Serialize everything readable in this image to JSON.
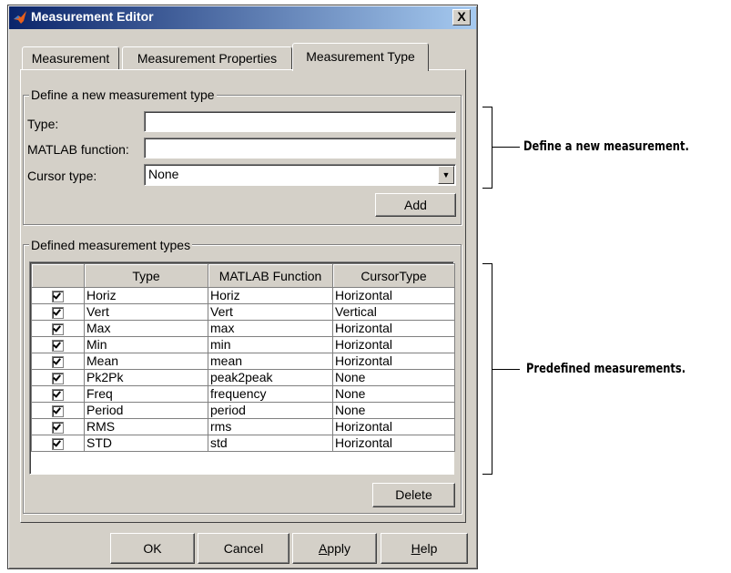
{
  "window": {
    "title": "Measurement Editor",
    "close_label": "X"
  },
  "tabs": [
    {
      "label": "Measurement",
      "active": false
    },
    {
      "label": "Measurement Properties",
      "active": false
    },
    {
      "label": "Measurement Type",
      "active": true
    }
  ],
  "define_group": {
    "legend": "Define a new measurement type",
    "type_label": "Type:",
    "type_value": "",
    "function_label": "MATLAB function:",
    "function_value": "",
    "cursor_label": "Cursor type:",
    "cursor_value": "None",
    "add_label": "Add"
  },
  "defined_group": {
    "legend": "Defined measurement types",
    "columns": [
      "",
      "Type",
      "MATLAB Function",
      "CursorType"
    ],
    "rows": [
      {
        "checked": true,
        "type": "Horiz",
        "function": "Horiz",
        "cursor": "Horizontal"
      },
      {
        "checked": true,
        "type": "Vert",
        "function": "Vert",
        "cursor": "Vertical"
      },
      {
        "checked": true,
        "type": "Max",
        "function": "max",
        "cursor": "Horizontal"
      },
      {
        "checked": true,
        "type": "Min",
        "function": "min",
        "cursor": "Horizontal"
      },
      {
        "checked": true,
        "type": "Mean",
        "function": "mean",
        "cursor": "Horizontal"
      },
      {
        "checked": true,
        "type": "Pk2Pk",
        "function": "peak2peak",
        "cursor": "None"
      },
      {
        "checked": true,
        "type": "Freq",
        "function": "frequency",
        "cursor": "None"
      },
      {
        "checked": true,
        "type": "Period",
        "function": "period",
        "cursor": "None"
      },
      {
        "checked": true,
        "type": "RMS",
        "function": "rms",
        "cursor": "Horizontal"
      },
      {
        "checked": true,
        "type": "STD",
        "function": "std",
        "cursor": "Horizontal"
      }
    ],
    "delete_label": "Delete"
  },
  "footer": {
    "ok_label": "OK",
    "cancel_label": "Cancel",
    "apply_label": "Apply",
    "apply_mnemonic": "A",
    "apply_rest": "pply",
    "help_label": "Help",
    "help_mnemonic": "H",
    "help_rest": "elp"
  },
  "annotations": {
    "define": "Define a new measurement.",
    "predefined": "Predefined measurements."
  },
  "colors": {
    "dialog_face": "#d4d0c8",
    "titlebar_start": "#0a246a",
    "titlebar_end": "#a6caf0"
  }
}
